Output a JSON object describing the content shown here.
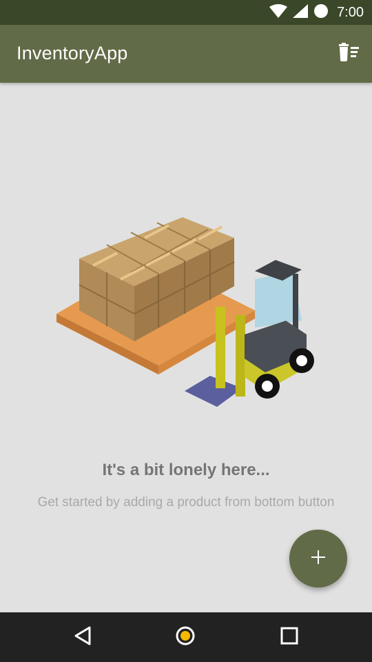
{
  "status_bar": {
    "time": "7:00",
    "icons": [
      "wifi-icon",
      "cellular-signal-icon",
      "battery-icon"
    ]
  },
  "app_bar": {
    "title": "InventoryApp",
    "action_icon": "delete-all-icon",
    "background": "#616b47"
  },
  "empty_state": {
    "illustration": "forklift-with-boxes",
    "title": "It's a bit lonely here...",
    "subtitle": "Get started by adding a product from bottom button"
  },
  "fab": {
    "icon": "plus-icon",
    "color": "#616b47"
  },
  "nav_bar": {
    "buttons": [
      "back-icon",
      "home-icon",
      "recents-icon"
    ],
    "home_accent": "#f6b900"
  }
}
